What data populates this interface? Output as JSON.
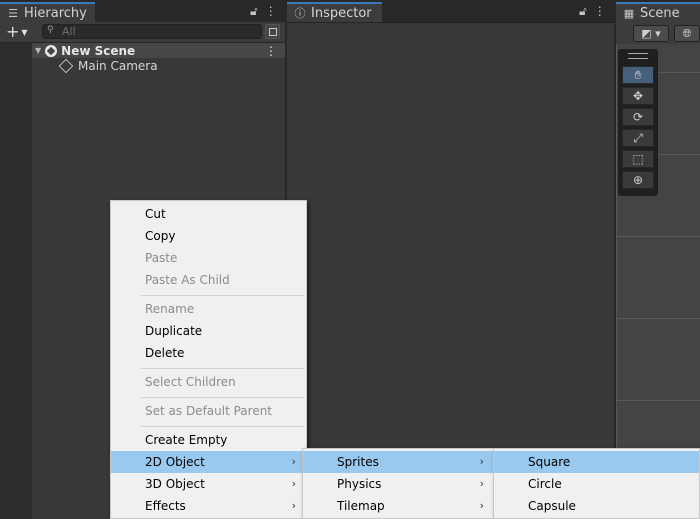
{
  "hierarchy": {
    "title": "Hierarchy",
    "search_placeholder": "All",
    "scene_name": "New Scene",
    "items": [
      "Main Camera"
    ]
  },
  "inspector": {
    "title": "Inspector"
  },
  "scene_panel": {
    "title": "Scene"
  },
  "context_menu": {
    "items": [
      {
        "label": "Cut",
        "enabled": true
      },
      {
        "label": "Copy",
        "enabled": true
      },
      {
        "label": "Paste",
        "enabled": false
      },
      {
        "label": "Paste As Child",
        "enabled": false
      },
      {
        "label": "Rename",
        "enabled": false
      },
      {
        "label": "Duplicate",
        "enabled": true
      },
      {
        "label": "Delete",
        "enabled": true
      },
      {
        "label": "Select Children",
        "enabled": false
      },
      {
        "label": "Set as Default Parent",
        "enabled": false
      },
      {
        "label": "Create Empty",
        "enabled": true
      },
      {
        "label": "2D Object",
        "enabled": true,
        "submenu": true,
        "highlighted": true
      },
      {
        "label": "3D Object",
        "enabled": true,
        "submenu": true
      },
      {
        "label": "Effects",
        "enabled": true,
        "submenu": true
      }
    ]
  },
  "submenu_2d": {
    "items": [
      {
        "label": "Sprites",
        "submenu": true,
        "highlighted": true
      },
      {
        "label": "Physics",
        "submenu": true
      },
      {
        "label": "Tilemap",
        "submenu": true
      }
    ]
  },
  "submenu_sprites": {
    "items": [
      {
        "label": "Square",
        "highlighted": true
      },
      {
        "label": "Circle"
      },
      {
        "label": "Capsule"
      }
    ]
  },
  "icons": {
    "hierarchy_tab": "list-icon",
    "inspector_tab": "info-icon",
    "scene_tab": "grid-icon",
    "lock": "lock-icon",
    "kebab": "kebab-menu-icon"
  },
  "colors": {
    "accent_tab": "#3a79bb",
    "menu_highlight": "#99c9ef",
    "panel_bg": "#383838"
  }
}
